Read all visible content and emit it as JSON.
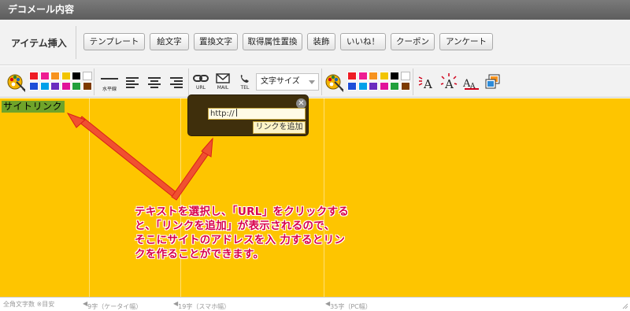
{
  "window": {
    "title": "デコメール内容"
  },
  "item_bar": {
    "label": "アイテム挿入",
    "buttons": [
      "テンプレート",
      "絵文字",
      "置換文字",
      "取得属性置換",
      "装飾",
      "いいね！",
      "クーポン",
      "アンケート"
    ]
  },
  "toolbar": {
    "text_colors": [
      "#ee1c25",
      "#ee1c92",
      "#f7931e",
      "#f2c500",
      "#000000",
      "#ffffff",
      "#1d4ed8",
      "#00a0e9",
      "#6a2cbf",
      "#e1119a",
      "#22a03c",
      "#7d3b00"
    ],
    "bg_colors": [
      "#ee1c25",
      "#ee1c92",
      "#f7931e",
      "#f2c500",
      "#000000",
      "#ffffff",
      "#1d4ed8",
      "#00a0e9",
      "#6a2cbf",
      "#e1119a",
      "#22a03c",
      "#7d3b00"
    ],
    "hr_label": "水平線",
    "url_label": "URL",
    "mail_label": "MAIL",
    "tel_label": "TEL",
    "font_size_select": "文字サイズ"
  },
  "editor": {
    "link_text": "サイトリンク",
    "bg_color": "#fec500"
  },
  "link_popup": {
    "close": "✕",
    "url_value": "http://",
    "add_button": "リンクを追加"
  },
  "annotation": {
    "text": "テキストを選択し、「URL」をクリックする\nと、「リンクを追加」が表示されるので、\nそこにサイトのアドレスを入 力するとリン\nクを作ることができます。",
    "color": "#d8004b"
  },
  "status_bar": {
    "full_width_count": "全角文字数 ※目安",
    "mark_9": "9字（ケータイ幅）",
    "mark_19": "19字（スマホ幅）",
    "mark_35": "35字（PC幅）"
  }
}
